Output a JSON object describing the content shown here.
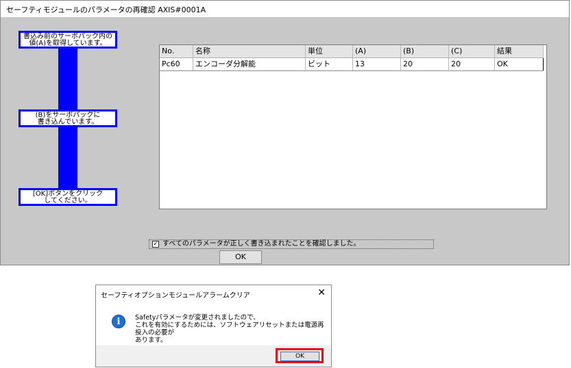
{
  "main_window": {
    "title": "セーフティモジュールのパラメータの再確認 AXIS#0001A",
    "steps": [
      "書込み前のサーボパック内の\n値(A)を取得しています。",
      "(B)をサーボパックに\n書き込んでいます。",
      "[OK]ボタンをクリック\nしてください。"
    ],
    "table": {
      "columns": [
        "No.",
        "名称",
        "単位",
        "(A)",
        "(B)",
        "(C)",
        "結果"
      ],
      "rows": [
        [
          "Pc60",
          "エンコーダ分解能",
          "ビット",
          "13",
          "20",
          "20",
          "OK"
        ]
      ]
    },
    "confirm_checkbox": {
      "checked": true,
      "label": "すべてのパラメータが正しく書き込まれたことを確認しました。"
    },
    "ok_label": "OK"
  },
  "dialog": {
    "title": "セーフティオプションモジュールアラームクリア",
    "close_glyph": "✕",
    "icon": "info-icon",
    "message": "Safetyパラメータが変更されましたので、\nこれを有効にするためには、ソフトウェアリセットまたは電源再投入の必要が\nあります。",
    "ok_label": "OK",
    "highlight_color": "#e60012"
  }
}
